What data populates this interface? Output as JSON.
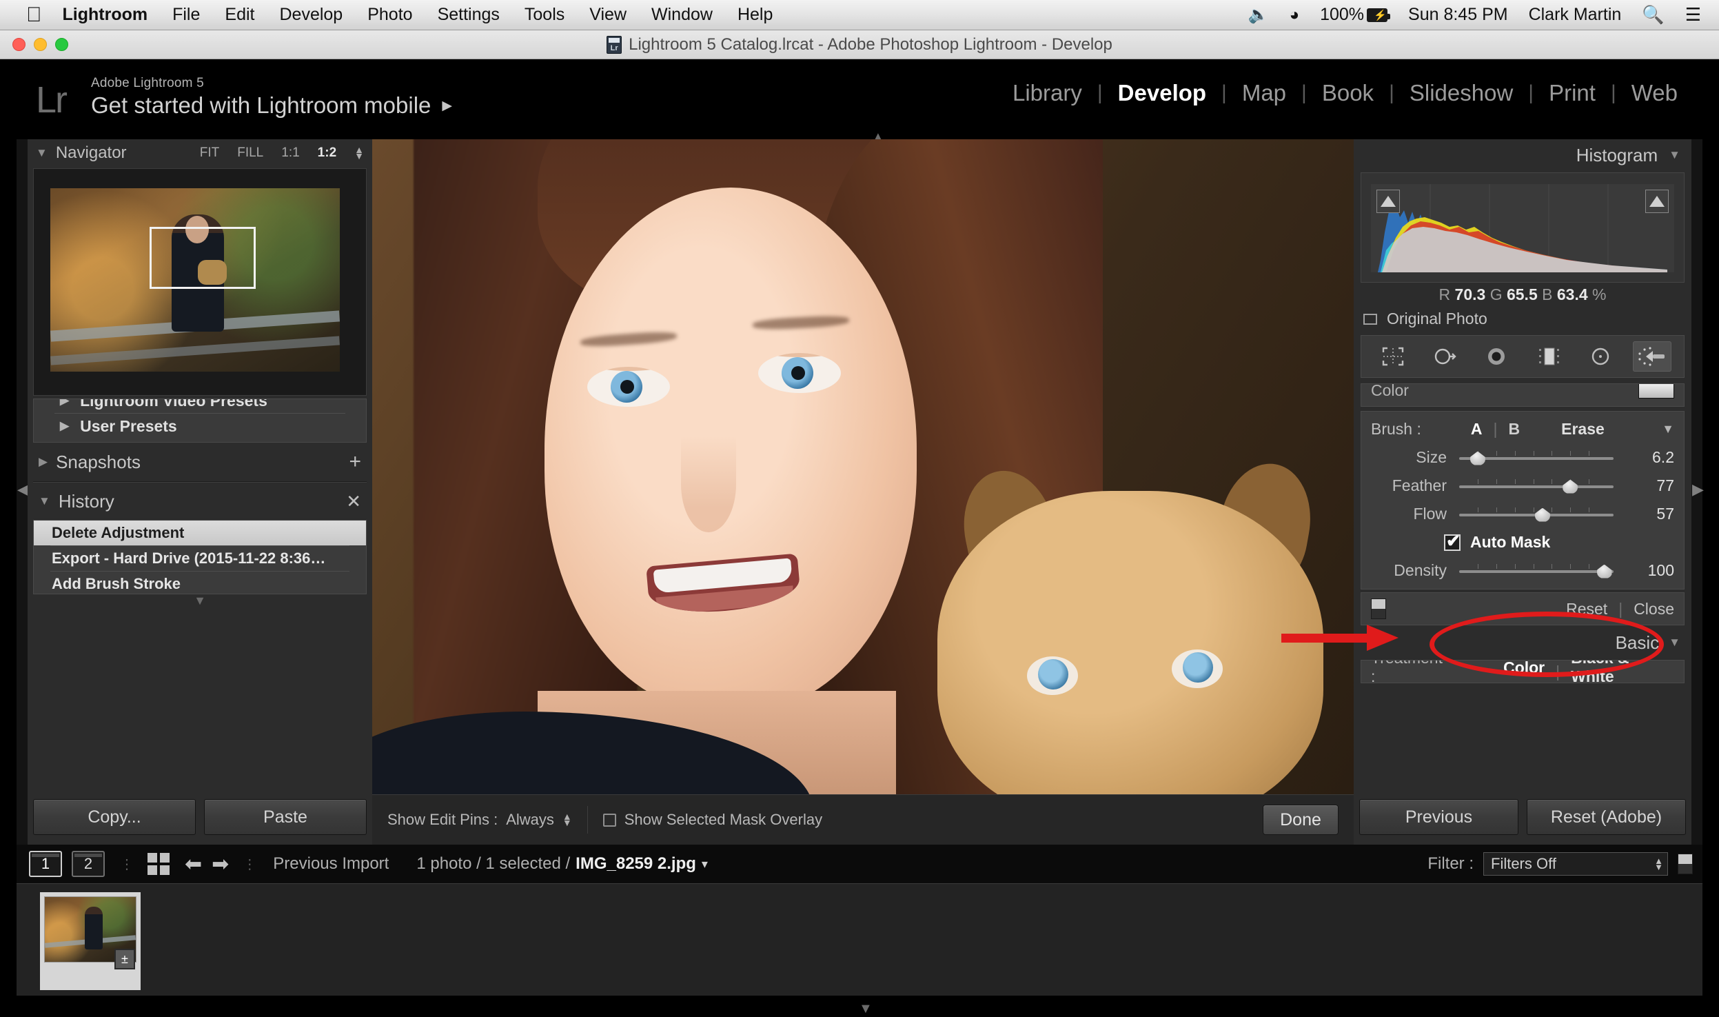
{
  "menubar": {
    "apple_icon": "apple-icon",
    "items": [
      "Lightroom",
      "File",
      "Edit",
      "Develop",
      "Photo",
      "Settings",
      "Tools",
      "View",
      "Window",
      "Help"
    ],
    "status": {
      "volume_icon": "volume-icon",
      "wifi_icon": "wifi-icon",
      "battery_percent": "100%",
      "battery_icon": "battery-charging-icon",
      "clock": "Sun 8:45 PM",
      "user": "Clark Martin",
      "search_icon": "search-icon",
      "notifications_icon": "list-icon"
    }
  },
  "window": {
    "title": "Lightroom 5 Catalog.lrcat - Adobe Photoshop Lightroom - Develop",
    "doc_icon": "lightroom-document-icon"
  },
  "identity": {
    "logo": "Lr",
    "product": "Adobe Lightroom 5",
    "tagline": "Get started with Lightroom mobile",
    "arrow": "▶"
  },
  "modules": {
    "items": [
      {
        "label": "Library",
        "active": false
      },
      {
        "label": "Develop",
        "active": true
      },
      {
        "label": "Map",
        "active": false
      },
      {
        "label": "Book",
        "active": false
      },
      {
        "label": "Slideshow",
        "active": false
      },
      {
        "label": "Print",
        "active": false
      },
      {
        "label": "Web",
        "active": false
      }
    ]
  },
  "left_panel": {
    "navigator": {
      "title": "Navigator",
      "zoom_modes": [
        "FIT",
        "FILL",
        "1:1"
      ],
      "selected_zoom": "1:2"
    },
    "presets": {
      "items": [
        {
          "label": "Lightroom Video Presets"
        },
        {
          "label": "User Presets"
        }
      ]
    },
    "snapshots": {
      "title": "Snapshots",
      "add_label": "+"
    },
    "history": {
      "title": "History",
      "clear_label": "✕",
      "items": [
        {
          "label": "Delete Adjustment",
          "selected": true
        },
        {
          "label": "Export - Hard Drive (2015-11-22 8:36…",
          "selected": false
        },
        {
          "label": "Add Brush Stroke",
          "selected": false
        }
      ]
    },
    "buttons": {
      "copy": "Copy...",
      "paste": "Paste"
    }
  },
  "toolbar": {
    "show_edit_pins_label": "Show Edit Pins :",
    "show_edit_pins_value": "Always",
    "mask_overlay_label": "Show Selected Mask Overlay",
    "mask_overlay_checked": false,
    "done_label": "Done"
  },
  "right_panel": {
    "histogram": {
      "title": "Histogram",
      "r_label": "R",
      "r_value": "70.3",
      "g_label": "G",
      "g_value": "65.5",
      "b_label": "B",
      "b_value": "63.4",
      "percent": "%",
      "original_photo": "Original Photo",
      "shadow_clip_icon": "shadow-clipping-icon",
      "highlight_clip_icon": "highlight-clipping-icon"
    },
    "tools": [
      {
        "name": "crop-overlay-tool",
        "active": false
      },
      {
        "name": "spot-removal-tool",
        "active": false
      },
      {
        "name": "red-eye-correction-tool",
        "active": false
      },
      {
        "name": "graduated-filter-tool",
        "active": false
      },
      {
        "name": "radial-filter-tool",
        "active": false
      },
      {
        "name": "adjustment-brush-tool",
        "active": true
      }
    ],
    "brush_panel": {
      "color_label": "Color",
      "brush_label": "Brush :",
      "brush_a": "A",
      "brush_b": "B",
      "brush_erase": "Erase",
      "sliders": [
        {
          "name": "Size",
          "value": "6.2",
          "pos": 12
        },
        {
          "name": "Feather",
          "value": "77",
          "pos": 72
        },
        {
          "name": "Flow",
          "value": "57",
          "pos": 54
        }
      ],
      "auto_mask_label": "Auto Mask",
      "auto_mask_checked": true,
      "density": {
        "name": "Density",
        "value": "100",
        "pos": 94
      },
      "reset_label": "Reset",
      "close_label": "Close"
    },
    "basic": {
      "title": "Basic",
      "treatment_label": "Treatment :",
      "treatment_color": "Color",
      "treatment_bw": "Black & White"
    },
    "buttons": {
      "previous": "Previous",
      "reset": "Reset (Adobe)"
    }
  },
  "filmstrip": {
    "view_1": "1",
    "view_2": "2",
    "grid_icon": "grid-view-icon",
    "back_icon": "arrow-left-icon",
    "forward_icon": "arrow-right-icon",
    "source": "Previous Import",
    "selection": "1 photo / 1 selected /",
    "filename": "IMG_8259 2.jpg",
    "filename_caret": "▾",
    "filter_label": "Filter :",
    "filter_value": "Filters Off",
    "thumb_badge": "±"
  },
  "annotations": {
    "ellipse": "red-ellipse-highlight",
    "arrow": "red-arrow-pointer"
  }
}
